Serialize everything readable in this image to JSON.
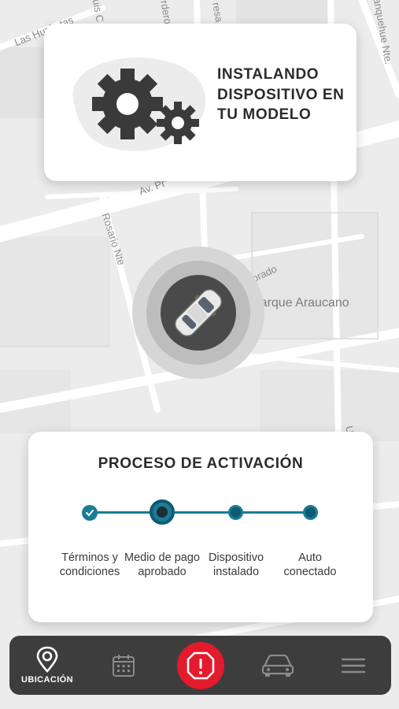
{
  "map": {
    "labels": [
      "Las Hualtatas",
      "uis C",
      "rdero",
      "resa",
      "anquehue Nte.",
      "Av. Pr",
      "Rosario Nte",
      "rro Colorado",
      "Parque Araucano",
      "Ur"
    ]
  },
  "install_card": {
    "title": "INSTALANDO DISPOSITIVO EN TU MODELO",
    "icon": "gears-icon"
  },
  "car_marker": {
    "icon": "car-top-view-icon"
  },
  "process": {
    "title": "PROCESO DE ACTIVACIÓN",
    "steps": [
      {
        "label": "Términos y condiciones",
        "status": "completed"
      },
      {
        "label": "Medio de pago aprobado",
        "status": "current"
      },
      {
        "label": "Dispositivo instalado",
        "status": "pending"
      },
      {
        "label": "Auto conectado",
        "status": "pending"
      }
    ],
    "accent_color": "#1a7c98"
  },
  "bottom_nav": {
    "items": [
      {
        "label": "UBICACIÓN",
        "icon": "location-pin-icon",
        "active": true
      },
      {
        "label": "",
        "icon": "calendar-icon",
        "active": false
      },
      {
        "label": "",
        "icon": "alert-icon",
        "active": false
      },
      {
        "label": "",
        "icon": "car-icon",
        "active": false
      },
      {
        "label": "",
        "icon": "menu-icon",
        "active": false
      }
    ],
    "sos_color": "#e31b2d",
    "background": "#3d3d3d"
  }
}
